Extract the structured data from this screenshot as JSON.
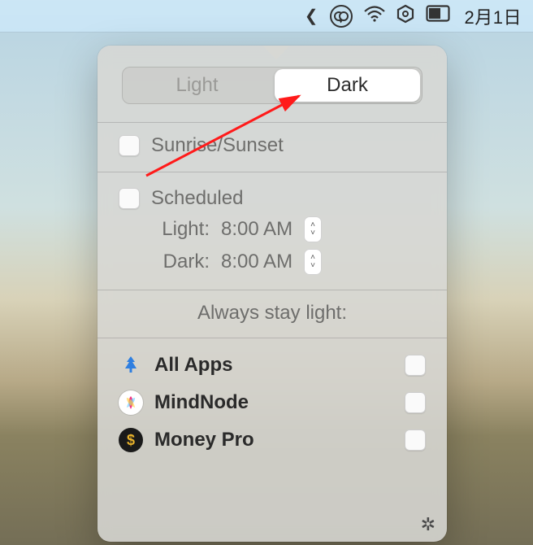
{
  "menubar": {
    "date": "2月1日"
  },
  "theme": {
    "light_label": "Light",
    "dark_label": "Dark",
    "active": "Dark"
  },
  "sunrise": {
    "label": "Sunrise/Sunset",
    "checked": false
  },
  "scheduled": {
    "label": "Scheduled",
    "checked": false,
    "light_label": "Light:",
    "light_time": "8:00 AM",
    "dark_label": "Dark:",
    "dark_time": "8:00 AM"
  },
  "always_stay_light": {
    "title": "Always stay light:",
    "apps": [
      {
        "name": "All Apps",
        "icon": "allapps",
        "checked": false
      },
      {
        "name": "MindNode",
        "icon": "mindnode",
        "checked": false
      },
      {
        "name": "Money Pro",
        "icon": "moneypro",
        "checked": false
      }
    ]
  }
}
